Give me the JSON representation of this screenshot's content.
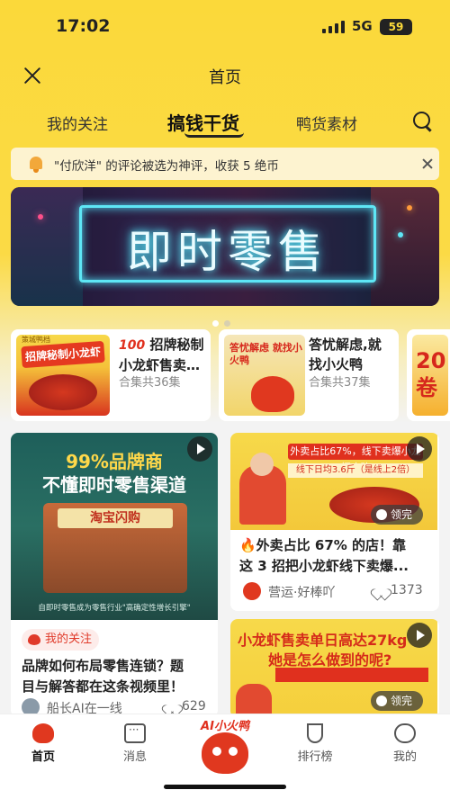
{
  "status_bar": {
    "time": "17:02",
    "network": "5G",
    "battery": "59"
  },
  "header": {
    "title": "首页"
  },
  "tabs": [
    {
      "label": "我的关注",
      "active": false
    },
    {
      "label": "搞钱干货",
      "active": true
    },
    {
      "label": "鸭货素材",
      "active": false
    }
  ],
  "notice": {
    "text": "\"付欣洋\" 的评论被选为神评，收获 5 绝币"
  },
  "banner": {
    "text": "即时零售",
    "page": 1,
    "pages": 2
  },
  "collections": [
    {
      "thumb_label": "招牌秘制小龙虾",
      "thumb_brand": "策城鸭档",
      "badge": "100",
      "title_line1": "招牌秘制",
      "title_line2": "小龙虾售卖…",
      "count": "合集共36集"
    },
    {
      "thumb_label": "答忧解虑 就找小火鸭",
      "title_line1": "答忧解虑,就",
      "title_line2": "找小火鸭",
      "count": "合集共37集"
    },
    {
      "thumb_label": "20 卷",
      "partial": true
    }
  ],
  "feed": [
    {
      "image_title1": "99%品牌商",
      "image_title2": "不懂即时零售渠道",
      "image_sign": "淘宝闪购",
      "image_caption": "自即时零售成为零售行业\"高确定性增长引擎\"",
      "tag": "我的关注",
      "title_line1": "品牌如何布局零售连锁？题",
      "title_line2": "目与解答都在这条视频里！",
      "author": "船长AI在一线",
      "likes": "629"
    },
    {
      "image_line1": "外卖占比67%，线下卖爆小龙虾攻略",
      "image_line2": "线下日均3.6斤（是线上2倍）",
      "done_label": "领完",
      "title_line1": "🔥外卖占比 67% 的店！靠",
      "title_line2": "这 3 招把小龙虾线下卖爆...",
      "author": "营运·好棒吖",
      "likes": "1373"
    },
    {
      "image_line1": "小龙虾售卖单日高达27kg",
      "image_line2": "她是怎么做到的呢?",
      "done_label": "领完"
    }
  ],
  "nav": {
    "items": [
      "首页",
      "消息",
      "排行榜",
      "我的"
    ],
    "center_label": "AI小火鸭"
  },
  "colors": {
    "accent": "#fbd93a",
    "brand_red": "#e0301e"
  }
}
